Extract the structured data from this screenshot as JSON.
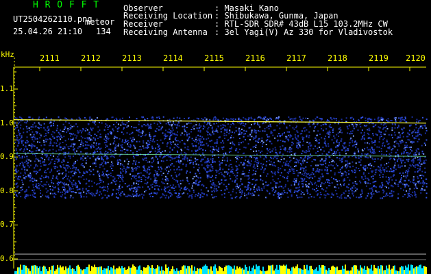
{
  "header": {
    "logo": "H R O F F T",
    "filename": "UT2504262110.png",
    "file_tag": "meteor",
    "datetime": "25.04.26 21:10",
    "count": "134",
    "fields": [
      {
        "label": "Observer",
        "value": ": Masaki Kano"
      },
      {
        "label": "Receiving Location",
        "value": ": Shibukawa, Gunma, Japan"
      },
      {
        "label": "Receiver",
        "value": ": RTL-SDR SDR# 43dB L15 103.2MHz CW"
      },
      {
        "label": "Receiving Antenna",
        "value": ": 3el Yagi(V) Az 330 for Vladivostok"
      }
    ]
  },
  "axis": {
    "unit": "kHz",
    "y_ticks": [
      "1.1",
      "1.0",
      "0.9",
      "0.8",
      "0.7",
      "0.6"
    ],
    "x_ticks": [
      "2111",
      "2112",
      "2113",
      "2114",
      "2115",
      "2116",
      "2117",
      "2118",
      "2119",
      "2120"
    ]
  },
  "colors": {
    "text": "#ffffff",
    "axis": "#ffff00",
    "logo": "#00ff00",
    "background": "#000000",
    "signal": "#3060ff",
    "carrier": "#ffff40"
  }
}
